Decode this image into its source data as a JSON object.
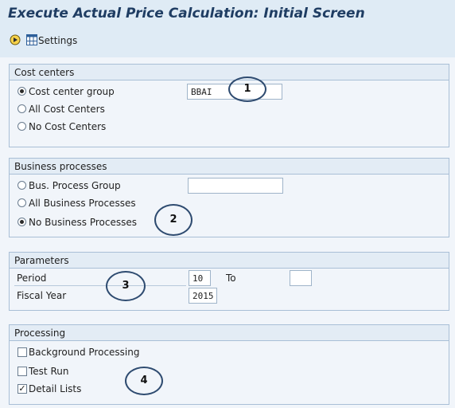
{
  "window": {
    "title": "Execute Actual Price Calculation: Initial Screen"
  },
  "toolbar": {
    "execute_icon": "execute-icon",
    "settings_icon": "settings-icon",
    "settings_label": "Settings"
  },
  "cost_centers": {
    "header": "Cost centers",
    "options": [
      {
        "label": "Cost center group",
        "selected": true
      },
      {
        "label": "All Cost Centers",
        "selected": false
      },
      {
        "label": "No Cost Centers",
        "selected": false
      }
    ],
    "group_value": "BBAI"
  },
  "business_processes": {
    "header": "Business processes",
    "options": [
      {
        "label": "Bus. Process Group",
        "selected": false
      },
      {
        "label": "All Business Processes",
        "selected": false
      },
      {
        "label": "No Business Processes",
        "selected": true
      }
    ],
    "group_value": ""
  },
  "parameters": {
    "header": "Parameters",
    "period_label": "Period",
    "period_value": "10",
    "to_label": "To",
    "to_value": "",
    "fiscal_year_label": "Fiscal Year",
    "fiscal_year_value": "2015"
  },
  "processing": {
    "header": "Processing",
    "options": [
      {
        "label": "Background Processing",
        "checked": false
      },
      {
        "label": "Test Run",
        "checked": false
      },
      {
        "label": "Detail Lists",
        "checked": true
      }
    ]
  },
  "callouts": [
    "1",
    "2",
    "3",
    "4"
  ]
}
